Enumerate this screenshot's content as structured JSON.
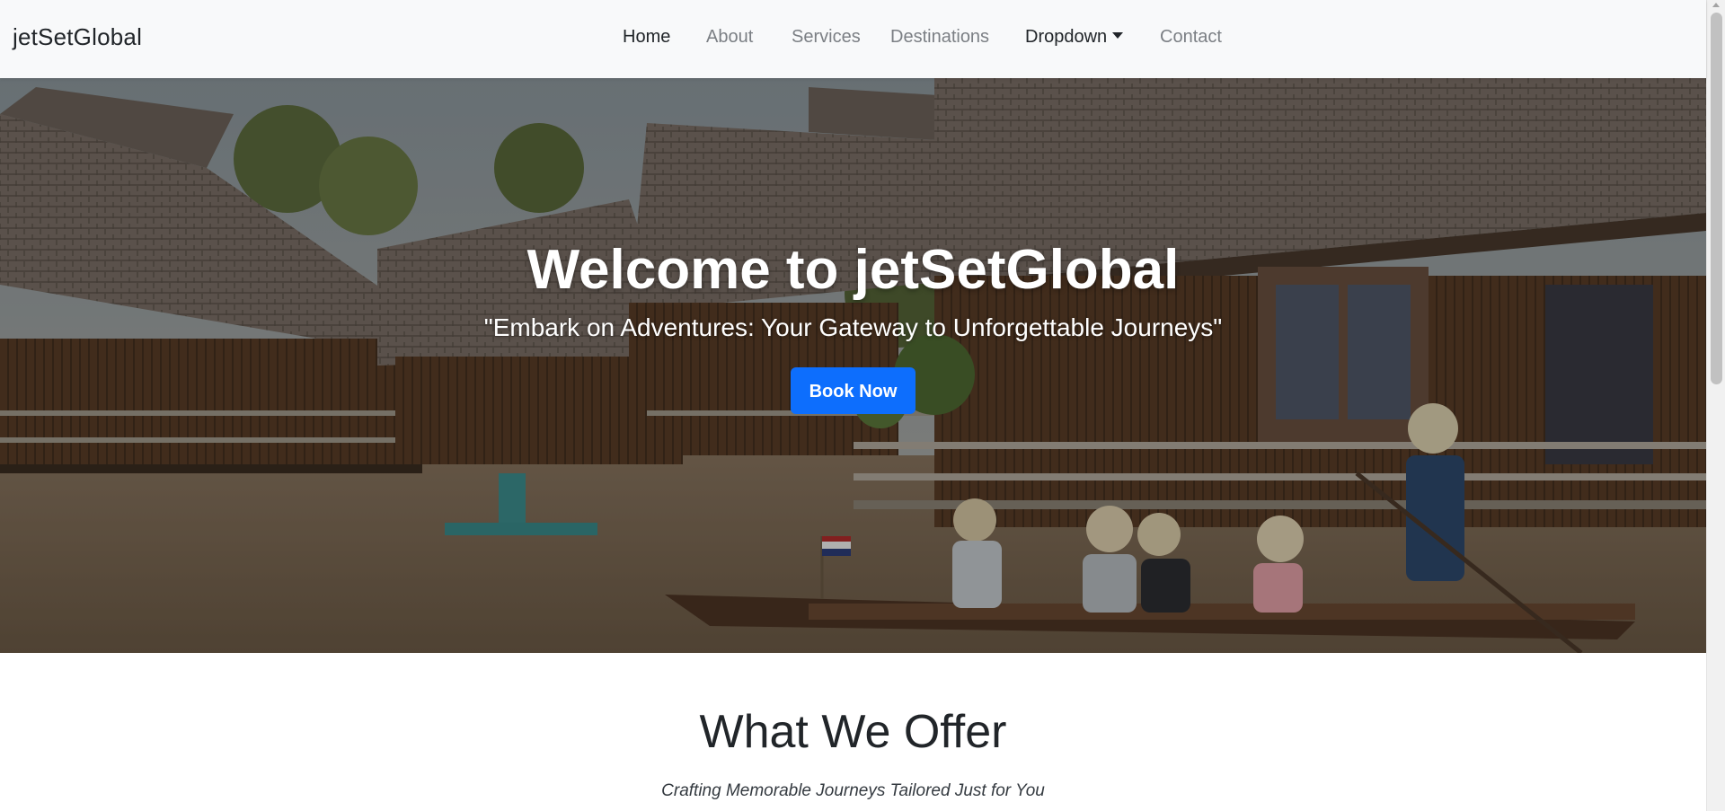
{
  "brand": "jetSetGlobal",
  "nav": {
    "items": [
      {
        "label": "Home"
      },
      {
        "label": "About"
      },
      {
        "label": "Services"
      },
      {
        "label": "Destinations"
      },
      {
        "label": "Dropdown"
      },
      {
        "label": "Contact"
      }
    ]
  },
  "hero": {
    "title": "Welcome to jetSetGlobal",
    "subtitle": "\"Embark on Adventures: Your Gateway to Unforgettable Journeys\"",
    "cta_label": "Book Now"
  },
  "offer": {
    "title": "What We Offer",
    "subtitle": "Crafting Memorable Journeys Tailored Just for You"
  },
  "colors": {
    "primary": "#0d6efd",
    "navbar_bg": "#f8f9fa",
    "text_dark": "#212529",
    "text_muted": "#7b7f84"
  }
}
